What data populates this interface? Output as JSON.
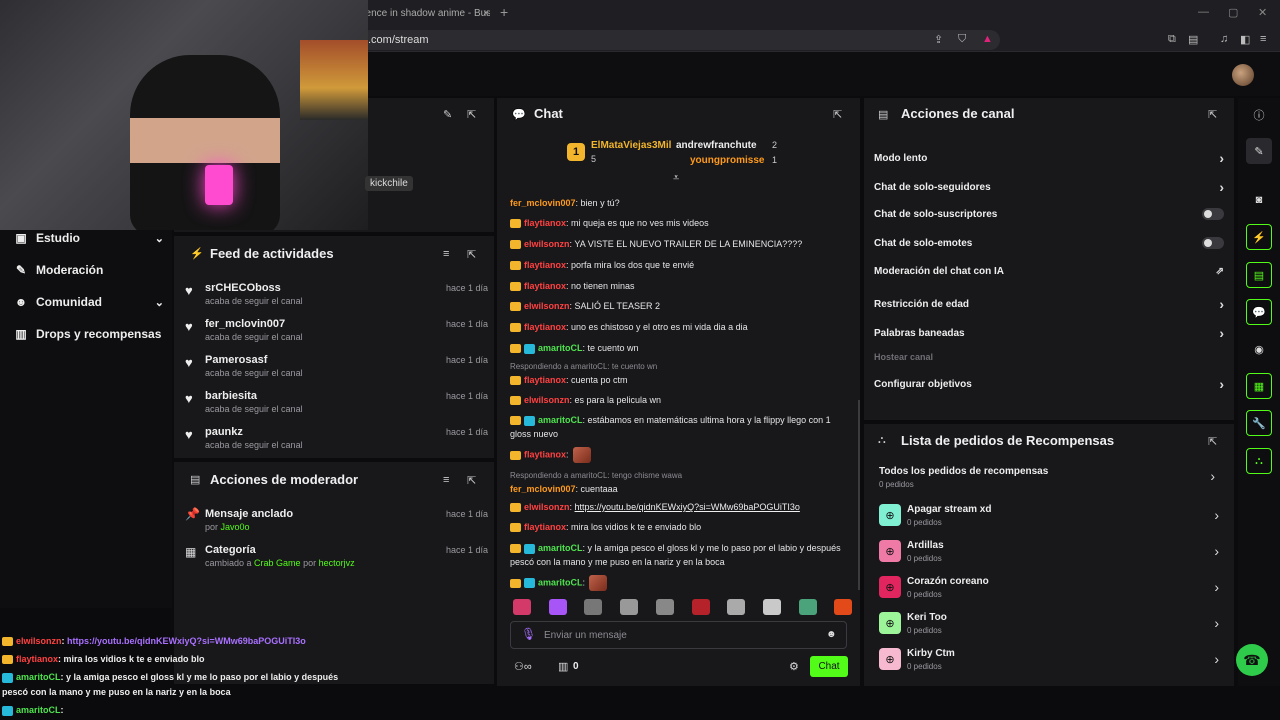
{
  "browser": {
    "tab_title": "nence in shadow anime - Buscar",
    "tab_plus": "+",
    "url": ".com/stream"
  },
  "webcam": {
    "tag": "kickchile"
  },
  "left_nav": {
    "items": [
      {
        "label": "Estudio",
        "icon": "video-icon",
        "glyph": "▣",
        "chevron": "⌄"
      },
      {
        "label": "Moderación",
        "icon": "wrench-icon",
        "glyph": "✎"
      },
      {
        "label": "Comunidad",
        "icon": "people-icon",
        "glyph": "☻",
        "chevron": "⌄"
      },
      {
        "label": "Drops y recompensas",
        "icon": "gift-icon",
        "glyph": "▥"
      }
    ]
  },
  "feed": {
    "title": "Feed de actividades",
    "rows": [
      {
        "name": "srCHECOboss",
        "sub": "acaba de seguir el canal",
        "time": "hace 1 día"
      },
      {
        "name": "fer_mclovin007",
        "sub": "acaba de seguir el canal",
        "time": "hace 1 día"
      },
      {
        "name": "Pamerosasf",
        "sub": "acaba de seguir el canal",
        "time": "hace 1 día"
      },
      {
        "name": "barbiesita",
        "sub": "acaba de seguir el canal",
        "time": "hace 1 día"
      },
      {
        "name": "paunkz",
        "sub": "acaba de seguir el canal",
        "time": "hace 1 día"
      }
    ]
  },
  "mod_actions": {
    "title": "Acciones de moderador",
    "rows": [
      {
        "name": "Mensaje anclado",
        "prefix": "por ",
        "user": "Javo0o",
        "mid": "",
        "by": "",
        "time": "hace 1 día"
      },
      {
        "name": "Categoría",
        "prefix": "cambiado a ",
        "user": "Crab Game",
        "mid": " por ",
        "by": "hectorjvz",
        "time": "hace 1 día"
      }
    ]
  },
  "chat": {
    "title": "Chat",
    "leaderboard": {
      "first": {
        "name": "ElMataViejas3Mil",
        "rank": "1",
        "count": "5"
      },
      "right": [
        {
          "name": "andrewfranchute",
          "count": "2"
        },
        {
          "name": "youngpromisse",
          "count": "1"
        }
      ]
    },
    "messages": [
      {
        "user": "fer_mclovin007",
        "color": "orange",
        "badges": [],
        "text": ": bien y tú?"
      },
      {
        "user": "flaytianox",
        "color": "red",
        "badges": [
          "crown"
        ],
        "text": ": mi queja es que no ves mis videos"
      },
      {
        "user": "elwilsonzn",
        "color": "red",
        "badges": [
          "crown"
        ],
        "text": ": YA VISTE EL NUEVO TRAILER DE LA EMINENCIA????"
      },
      {
        "user": "flaytianox",
        "color": "red",
        "badges": [
          "crown"
        ],
        "text": ": porfa mira los dos que te envié"
      },
      {
        "user": "flaytianox",
        "color": "red",
        "badges": [
          "crown"
        ],
        "text": ": no tienen minas"
      },
      {
        "user": "elwilsonzn",
        "color": "red",
        "badges": [
          "crown"
        ],
        "text": ": SALIÓ EL TEASER 2"
      },
      {
        "user": "flaytianox",
        "color": "red",
        "badges": [
          "crown"
        ],
        "text": ": uno es chistoso y el otro es mi vida dia a dia"
      },
      {
        "user": "amaritoCL",
        "color": "green",
        "badges": [
          "crown",
          "sub"
        ],
        "text": ": te cuento wn"
      },
      {
        "reply": "Respondiendo a amaritoCL: te cuento wn",
        "user": "flaytianox",
        "color": "red",
        "badges": [
          "crown"
        ],
        "text": ": cuenta po ctm"
      },
      {
        "user": "elwilsonzn",
        "color": "red",
        "badges": [
          "crown"
        ],
        "text": ": es para la pelicula wn"
      },
      {
        "user": "amaritoCL",
        "color": "green",
        "badges": [
          "crown",
          "sub"
        ],
        "text": ": estábamos en matemáticas ultima hora y la flippy llego con 1 gloss nuevo"
      },
      {
        "user": "flaytianox",
        "color": "red",
        "badges": [
          "crown"
        ],
        "text": ":",
        "emote": true
      },
      {
        "reply": "Respondiendo a amaritoCL: tengo chisme wawa",
        "user": "fer_mclovin007",
        "color": "orange",
        "badges": [],
        "text": ": cuentaaa"
      },
      {
        "user": "elwilsonzn",
        "color": "red",
        "badges": [
          "crown"
        ],
        "text": ": ",
        "link": "https://youtu.be/qidnKEWxiyQ?si=WMw69baPOGUiTI3o"
      },
      {
        "user": "flaytianox",
        "color": "red",
        "badges": [
          "crown"
        ],
        "text": ": mira los vidios k te e enviado blo"
      },
      {
        "user": "amaritoCL",
        "color": "green",
        "badges": [
          "crown",
          "sub"
        ],
        "text": ": y la amiga pesco el gloss kl y me lo paso por el labio y después pescó con la mano y me puso en la nariz y en la boca"
      },
      {
        "user": "amaritoCL",
        "color": "green",
        "badges": [
          "crown",
          "sub"
        ],
        "text": ":",
        "emote": true
      }
    ],
    "input_placeholder": "Enviar un mensaje",
    "points": "0",
    "send_label": "Chat"
  },
  "channel_actions": {
    "title": "Acciones de canal",
    "rows": [
      {
        "label": "Modo lento",
        "control": "chevron"
      },
      {
        "label": "Chat de solo-seguidores",
        "control": "chevron"
      },
      {
        "label": "Chat de solo-suscriptores",
        "control": "toggle"
      },
      {
        "label": "Chat de solo-emotes",
        "control": "toggle"
      },
      {
        "label": "Moderación del chat con IA",
        "control": "external"
      },
      {
        "label": "Restricción de edad",
        "control": "chevron"
      },
      {
        "label": "Palabras baneadas",
        "control": "chevron"
      },
      {
        "label": "Hostear canal",
        "control": "none",
        "disabled": true
      },
      {
        "label": "Configurar objetivos",
        "control": "chevron"
      }
    ]
  },
  "rewards": {
    "title": "Lista de pedidos de Recompensas",
    "all": {
      "name": "Todos los pedidos de recompensas",
      "sub": "0 pedidos"
    },
    "rows": [
      {
        "name": "Apagar stream xd",
        "sub": "0 pedidos",
        "color": "#7ff0d2"
      },
      {
        "name": "Ardillas",
        "sub": "0 pedidos",
        "color": "#f07aa6"
      },
      {
        "name": "Corazón coreano",
        "sub": "0 pedidos",
        "color": "#e0255f"
      },
      {
        "name": "Keri Too",
        "sub": "0 pedidos",
        "color": "#9df59a"
      },
      {
        "name": "Kirby Ctm",
        "sub": "0 pedidos",
        "color": "#f7b9cf"
      }
    ]
  },
  "overlay_chat": [
    {
      "user": "elwilsonzn",
      "color": "red",
      "text": ": ",
      "link": "https://youtu.be/qidnKEWxiyQ?si=WMw69baPOGUiTI3o"
    },
    {
      "user": "flaytianox",
      "color": "red",
      "text": ": mira los vidios k te e enviado blo"
    },
    {
      "user": "amaritoCL",
      "color": "green",
      "text": ": y la amiga pesco el gloss kl y me lo paso por el labio y después"
    },
    {
      "user": "",
      "color": "",
      "text": "pescó con la mano y me puso en la nariz y en la boca"
    },
    {
      "user": "amaritoCL",
      "color": "green",
      "text": ":"
    }
  ],
  "colors": {
    "accent": "#53fc18",
    "panel": "#18181b",
    "bg": "#0b0b0d"
  }
}
